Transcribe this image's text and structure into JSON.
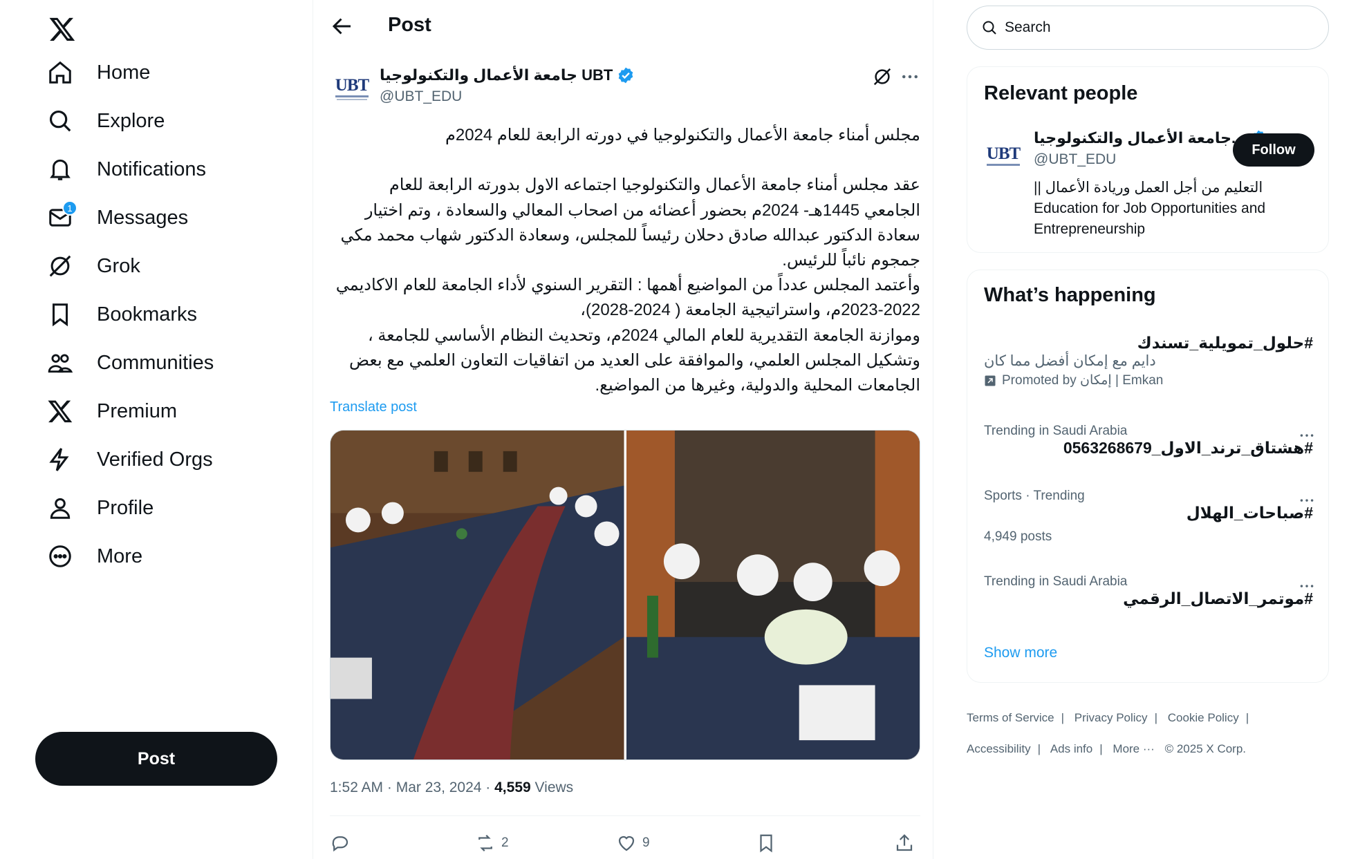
{
  "nav": {
    "items": [
      {
        "label": "Home",
        "icon": "home-icon"
      },
      {
        "label": "Explore",
        "icon": "search-icon"
      },
      {
        "label": "Notifications",
        "icon": "bell-icon"
      },
      {
        "label": "Messages",
        "icon": "mail-icon"
      },
      {
        "label": "Grok",
        "icon": "grok-icon"
      },
      {
        "label": "Bookmarks",
        "icon": "bookmark-icon"
      },
      {
        "label": "Communities",
        "icon": "communities-icon"
      },
      {
        "label": "Premium",
        "icon": "x-logo-icon"
      },
      {
        "label": "Verified Orgs",
        "icon": "lightning-icon"
      },
      {
        "label": "Profile",
        "icon": "person-icon"
      },
      {
        "label": "More",
        "icon": "more-circle-icon"
      }
    ],
    "messages_badge": "1",
    "post_button": "Post"
  },
  "header": {
    "title": "Post"
  },
  "post": {
    "author_name": "جامعة الأعمال والتكنولوجيا UBT",
    "author_handle": "@UBT_EDU",
    "avatar_text": "UBT",
    "text": "مجلس أمناء جامعة الأعمال والتكنولوجيا في دورته الرابعة للعام 2024م\n\nعقد مجلس أمناء جامعة الأعمال والتكنولوجيا اجتماعه الاول بدورته الرابعة للعام الجامعي 1445هـ- 2024م بحضور أعضائه من اصحاب المعالي والسعادة ، وتم اختيار سعادة الدكتور عبدالله صادق دحلان رئيساً للمجلس، وسعادة الدكتور شهاب محمد مكي جمجوم نائباً للرئيس.\nوأعتمد المجلس عدداً من المواضيع أهمها : التقرير السنوي لأداء الجامعة للعام الاكاديمي 2022-2023م، واستراتيجية الجامعة ( 2024-2028)،\nوموازنة الجامعة التقديرية للعام المالي 2024م، وتحديث النظام الأساسي للجامعة ،\nوتشكيل المجلس العلمي، والموافقة على العديد من اتفاقيات التعاون العلمي مع بعض الجامعات المحلية والدولية، وغيرها من المواضيع.",
    "translate_label": "Translate post",
    "time": "1:52 AM · Mar 23, 2024 · ",
    "views_count": "4,559",
    "views_label": " Views",
    "actions": {
      "replies": "",
      "reposts": "2",
      "likes": "9"
    }
  },
  "search": {
    "placeholder": "Search"
  },
  "relevant_people": {
    "title": "Relevant people",
    "name": "جامعة الأعمال والتكنولوجيا...",
    "handle": "@UBT_EDU",
    "follow_label": "Follow",
    "bio_ar": "التعليم من أجل العمل وريادة الأعمال ||",
    "bio_en": "Education for Job Opportunities and Entrepreneurship"
  },
  "whats_happening": {
    "title": "What’s happening",
    "promoted": {
      "title": "#حلول_تمويلية_تسندك",
      "desc": "دايم مع إمكان أفضل مما كان",
      "by": "Promoted by إمكان | Emkan"
    },
    "trends": [
      {
        "category": "Trending in Saudi Arabia",
        "title": "#هشتاق_ترند_الاول_0563268679",
        "sub": ""
      },
      {
        "category": "Sports · Trending",
        "title": "#صباحات_الهلال",
        "sub": "4,949 posts"
      },
      {
        "category": "Trending in Saudi Arabia",
        "title": "#موتمر_الاتصال_الرقمي",
        "sub": ""
      }
    ],
    "show_more": "Show more"
  },
  "footer": {
    "links": [
      "Terms of Service",
      "Privacy Policy",
      "Cookie Policy",
      "Accessibility",
      "Ads info",
      "More ···"
    ],
    "copyright": "© 2025 X Corp."
  },
  "colors": {
    "accent": "#1d9bf0",
    "text": "#0f1419",
    "muted": "#536471",
    "border": "#eff3f4"
  }
}
